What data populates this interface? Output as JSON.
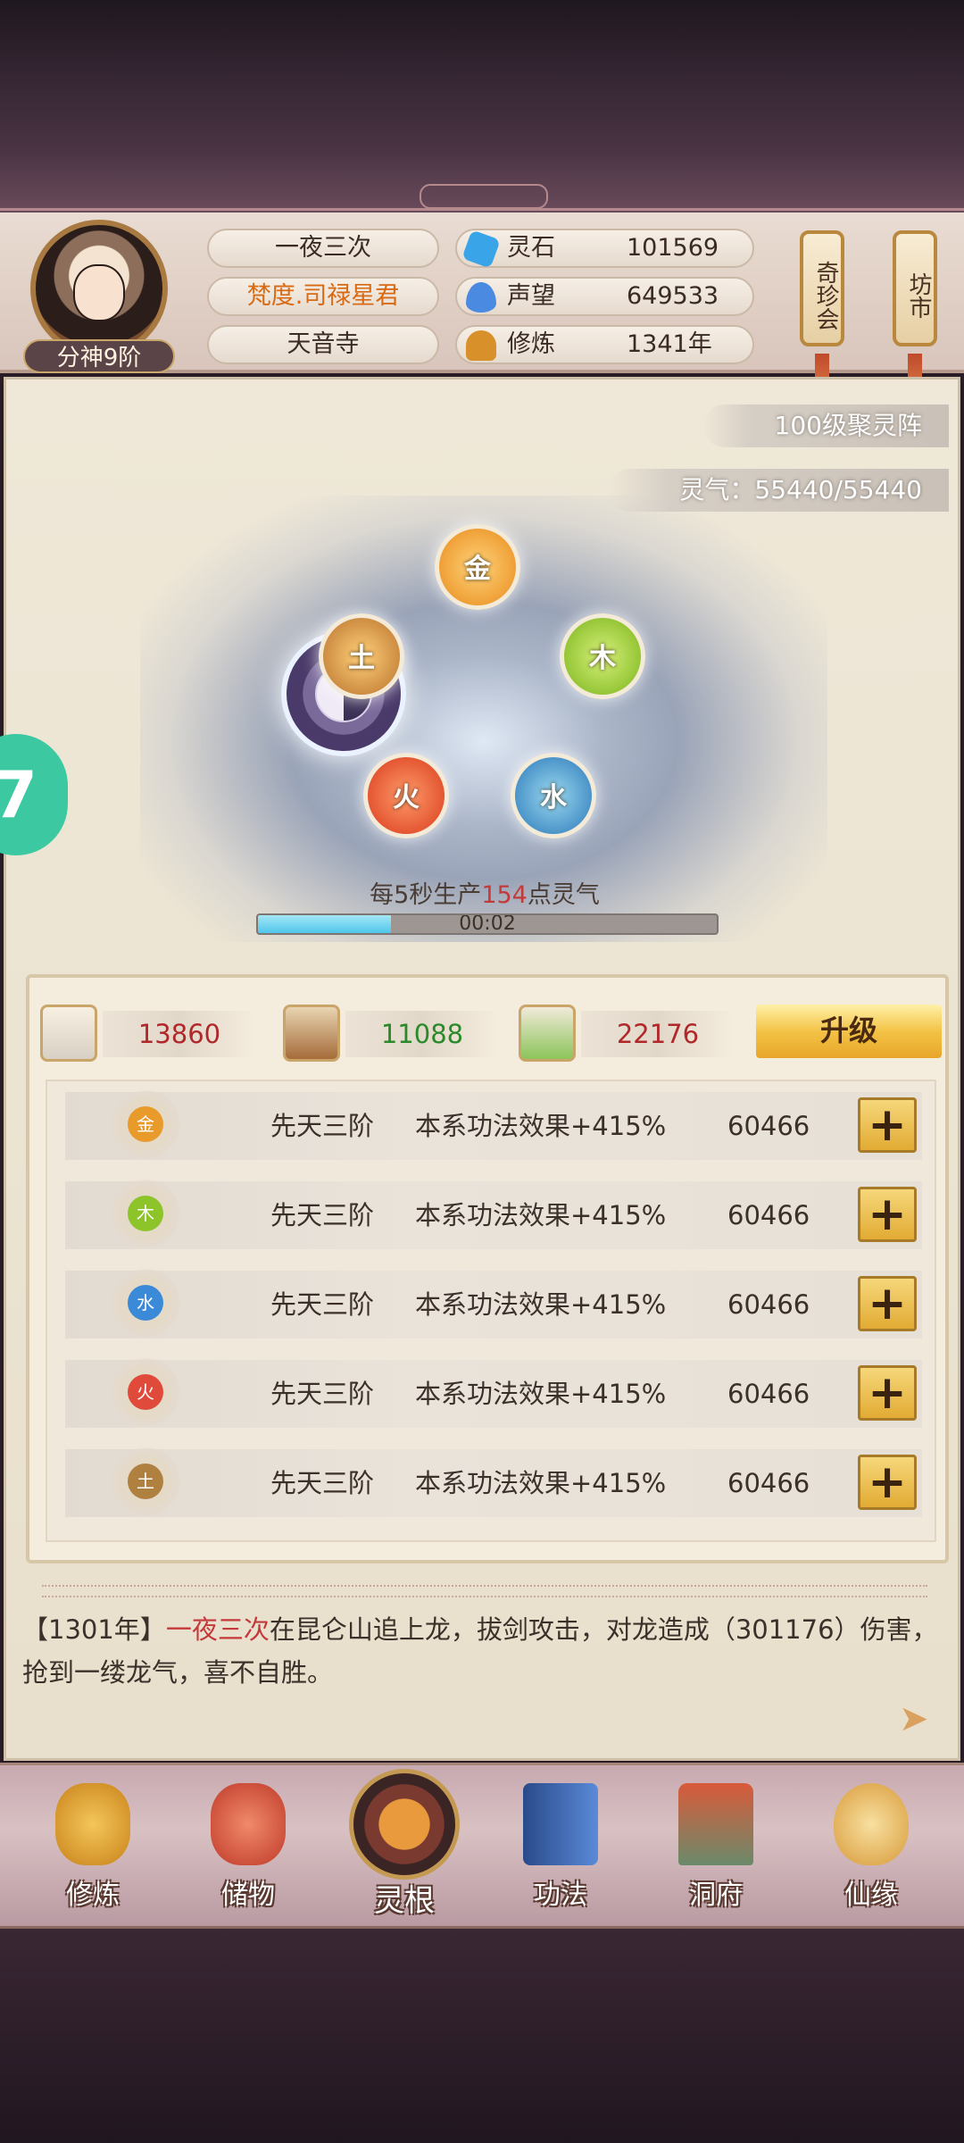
{
  "player": {
    "rank": "分神9阶",
    "name": "一夜三次",
    "title": "梵度.司禄星君",
    "sect": "天音寺"
  },
  "resources": [
    {
      "label": "灵石",
      "value": "101569",
      "icon": "spirit-stone-icon",
      "color": "#3aa4e8"
    },
    {
      "label": "声望",
      "value": "649533",
      "icon": "reputation-crystal-icon",
      "color": "#4a8ae0"
    },
    {
      "label": "修炼",
      "value": "1341年",
      "icon": "meditation-icon",
      "color": "#d8902a"
    }
  ],
  "side_buttons": {
    "treasure": "奇珍会",
    "market": "坊市"
  },
  "formation": {
    "level_tag": "100级聚灵阵",
    "qi_tag": "灵气：55440/55440",
    "elements": [
      "金",
      "木",
      "水",
      "火",
      "土"
    ],
    "production_prefix": "每5秒生产",
    "production_value": "154",
    "production_suffix": "点灵气",
    "timer": "00:02",
    "timer_progress": 0.29
  },
  "upgrade_cost": {
    "items": [
      {
        "value": "13860",
        "color": "#b0282a",
        "icon": "ore-icon"
      },
      {
        "value": "11088",
        "color": "#2a8a2a",
        "icon": "wood-logs-icon"
      },
      {
        "value": "22176",
        "color": "#b0282a",
        "icon": "herb-icon"
      }
    ],
    "upgrade_label": "升级"
  },
  "element_rows": [
    {
      "element": "金",
      "tier": "先天三阶",
      "effect": "本系功法效果+415%",
      "cost": "60466",
      "color": "#e89a2a"
    },
    {
      "element": "木",
      "tier": "先天三阶",
      "effect": "本系功法效果+415%",
      "cost": "60466",
      "color": "#8cc42a"
    },
    {
      "element": "水",
      "tier": "先天三阶",
      "effect": "本系功法效果+415%",
      "cost": "60466",
      "color": "#3a8ad8"
    },
    {
      "element": "火",
      "tier": "先天三阶",
      "effect": "本系功法效果+415%",
      "cost": "60466",
      "color": "#e04a3a"
    },
    {
      "element": "土",
      "tier": "先天三阶",
      "effect": "本系功法效果+415%",
      "cost": "60466",
      "color": "#b08040"
    }
  ],
  "plus_label": "+",
  "log": {
    "prefix": "【1301年】",
    "name": "一夜三次",
    "text": "在昆仑山追上龙，拔剑攻击，对龙造成（301176）伤害，抢到一缕龙气，喜不自胜。"
  },
  "float_label": "7",
  "nav": [
    {
      "label": "修炼",
      "icon": "cultivate-icon",
      "color": "#d89a2a"
    },
    {
      "label": "储物",
      "icon": "storage-bag-icon",
      "color": "#d8503a"
    },
    {
      "label": "灵根",
      "icon": "spirit-root-icon",
      "color": "#e07a2a"
    },
    {
      "label": "功法",
      "icon": "scripture-book-icon",
      "color": "#3a6ab8"
    },
    {
      "label": "洞府",
      "icon": "cave-mansion-icon",
      "color": "#c84a3a"
    },
    {
      "label": "仙缘",
      "icon": "gourd-icon",
      "color": "#e0a84a"
    }
  ]
}
